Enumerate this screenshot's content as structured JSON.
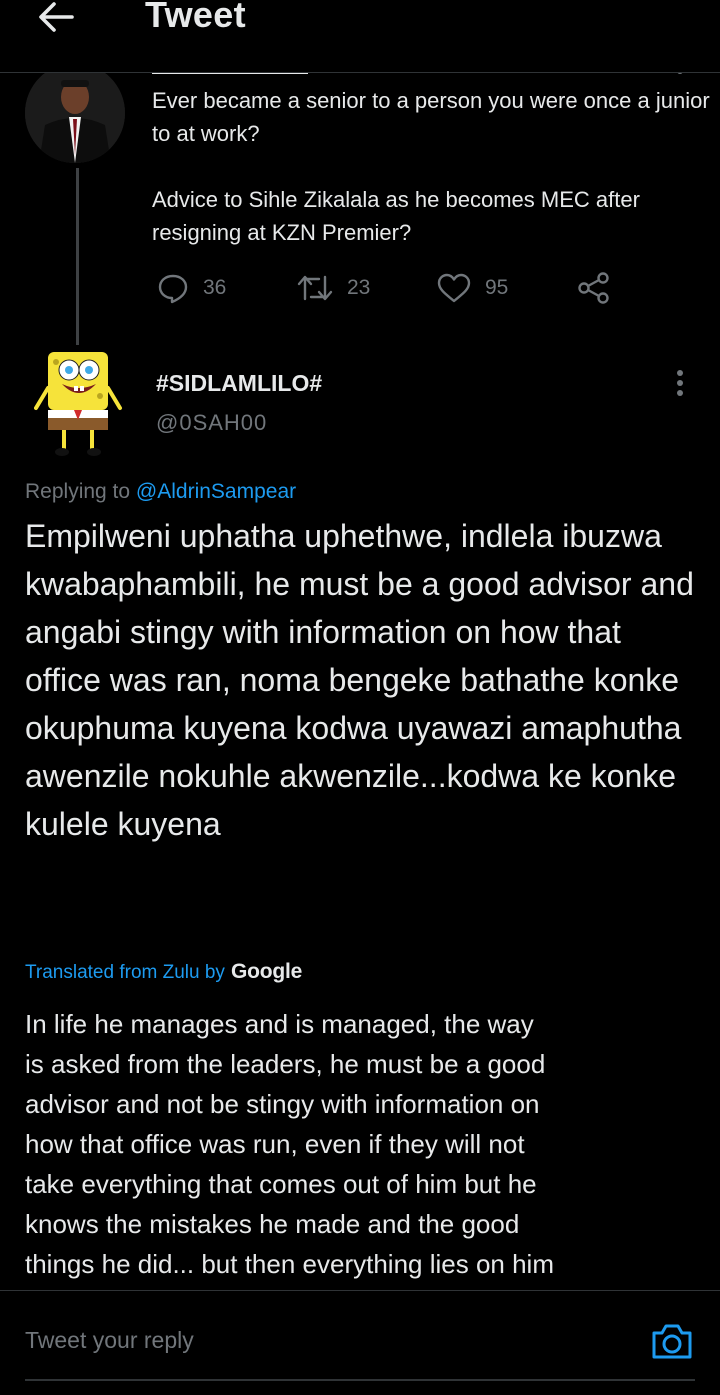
{
  "header": {
    "title": "Tweet"
  },
  "parent_tweet": {
    "text": "Ever became a senior to a person you were once a junior to at work?\n\nAdvice to Sihle Zikalala as he becomes MEC after resigning at KZN Premier?",
    "replies": "36",
    "retweets": "23",
    "likes": "95"
  },
  "reply_tweet": {
    "display_name": "#SIDLAMLILO#",
    "handle": "@0SAH00",
    "replying_prefix": "Replying to",
    "replying_to": "@AldrinSampear",
    "text": "Empilweni uphatha uphethwe, indlela ibuzwa kwabaphambili, he must be a good advisor and angabi stingy with information on how that office was ran, noma bengeke bathathe konke okuphuma kuyena kodwa uyawazi amaphutha awenzile nokuhle akwenzile...kodwa ke konke kulele kuyena",
    "translated_label": "Translated from Zulu by",
    "translator": "Google",
    "translation": "In life he manages and is managed, the way\nis asked from the leaders, he must be a good\nadvisor and not be stingy with information on\nhow that office was run, even if they will not\ntake everything that comes out of him but he\nknows the mistakes he made and the good\nthings he did... but then everything lies on him"
  },
  "reply_box": {
    "placeholder": "Tweet your reply"
  },
  "colors": {
    "background": "#000000",
    "text": "#e7e9ea",
    "muted": "#71767b",
    "accent": "#1d9bf0"
  }
}
